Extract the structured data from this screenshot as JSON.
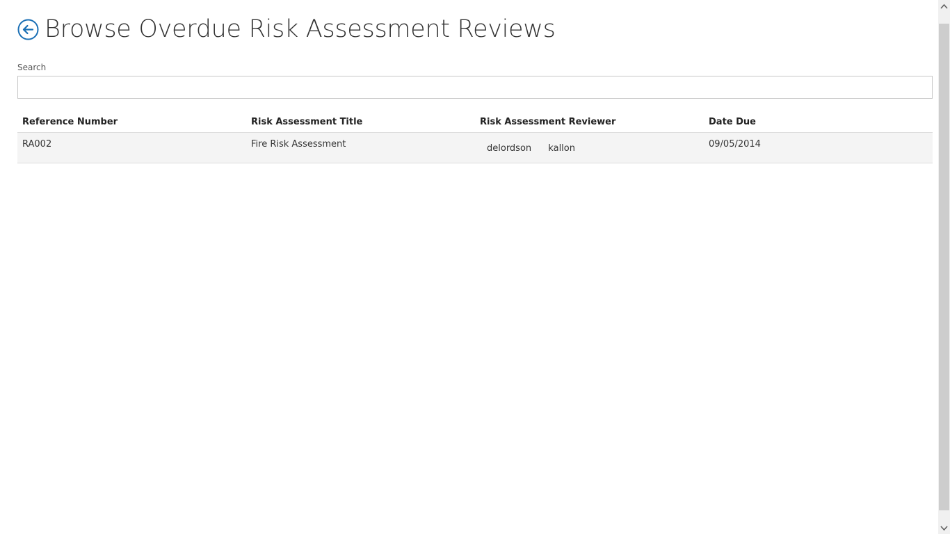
{
  "page": {
    "title": "Browse Overdue Risk Assessment Reviews",
    "accent_color": "#1a6fb5"
  },
  "search": {
    "label": "Search",
    "value": "",
    "placeholder": ""
  },
  "table": {
    "columns": [
      "Reference Number",
      "Risk Assessment Title",
      "Risk Assessment Reviewer",
      "Date Due"
    ],
    "rows": [
      {
        "reference": "RA002",
        "title": "Fire Risk Assessment",
        "reviewers": [
          "delordson",
          "kallon"
        ],
        "date_due": "09/05/2014"
      }
    ]
  },
  "icons": {
    "back": "back-arrow-circle-icon",
    "scroll_up": "chevron-up-icon",
    "scroll_down": "chevron-down-icon"
  }
}
